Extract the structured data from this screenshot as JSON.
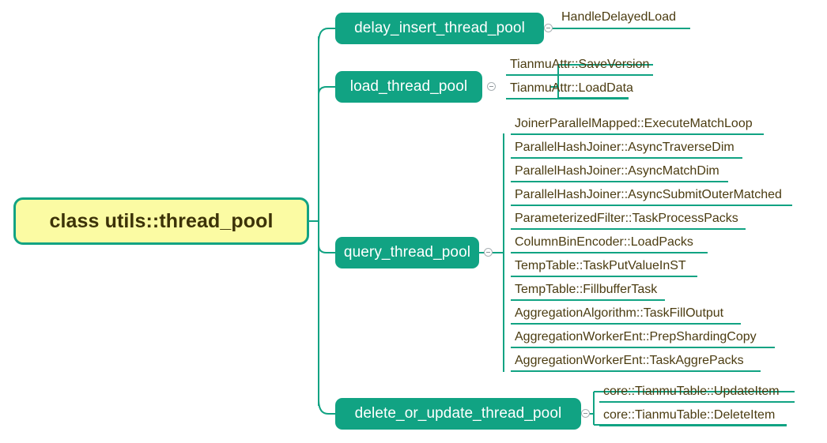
{
  "diagram": {
    "type": "mind-map",
    "background_color": "#ffffff",
    "colors": {
      "root_fill": "#fbfba3",
      "root_border": "#12a383",
      "root_text": "#3c3208",
      "branch_fill": "#11a383",
      "branch_text": "#ffffff",
      "leaf_text": "#4b3c11",
      "connector": "#11a383",
      "toggle_border": "#a9b0b4"
    },
    "root": {
      "label": "class utils::thread_pool"
    },
    "branches": [
      {
        "id": "delay-insert-thread-pool",
        "label": "delay_insert_thread_pool",
        "leaves": [
          {
            "label": "HandleDelayedLoad"
          }
        ]
      },
      {
        "id": "load-thread-pool",
        "label": "load_thread_pool",
        "leaves": [
          {
            "label": "TianmuAttr::SaveVersion"
          },
          {
            "label": "TianmuAttr::LoadData"
          }
        ]
      },
      {
        "id": "query-thread-pool",
        "label": "query_thread_pool",
        "leaves": [
          {
            "label": "JoinerParallelMapped::ExecuteMatchLoop"
          },
          {
            "label": "ParallelHashJoiner::AsyncTraverseDim"
          },
          {
            "label": "ParallelHashJoiner::AsyncMatchDim"
          },
          {
            "label": "ParallelHashJoiner::AsyncSubmitOuterMatched"
          },
          {
            "label": "ParameterizedFilter::TaskProcessPacks"
          },
          {
            "label": "ColumnBinEncoder::LoadPacks"
          },
          {
            "label": "TempTable::TaskPutValueInST"
          },
          {
            "label": "TempTable::FillbufferTask"
          },
          {
            "label": "AggregationAlgorithm::TaskFillOutput"
          },
          {
            "label": "AggregationWorkerEnt::PrepShardingCopy"
          },
          {
            "label": "AggregationWorkerEnt::TaskAggrePacks"
          }
        ]
      },
      {
        "id": "delete-or-update-thread-pool",
        "label": "delete_or_update_thread_pool",
        "leaves": [
          {
            "label": "core::TianmuTable::UpdateItem"
          },
          {
            "label": "core::TianmuTable::DeleteItem"
          }
        ]
      }
    ]
  }
}
